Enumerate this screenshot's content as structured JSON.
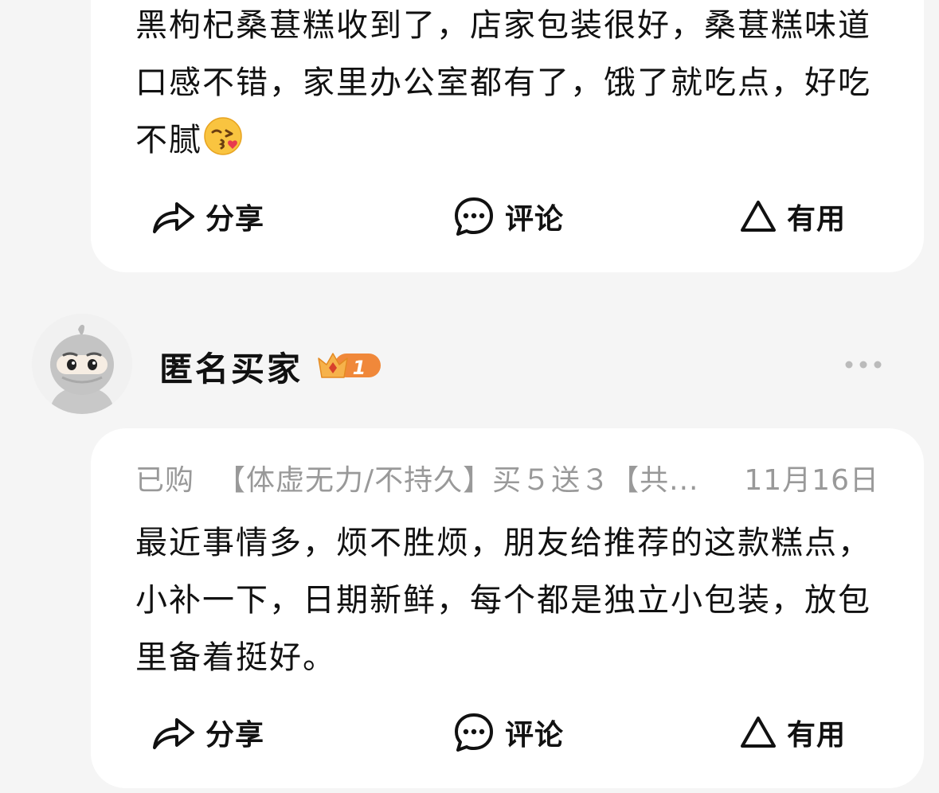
{
  "reviews": [
    {
      "text": "黑枸杞桑葚糕收到了，店家包装很好，桑葚糕味道口感不错，家里办公室都有了，饿了就吃点，好吃不腻",
      "actions": {
        "share": "分享",
        "comment": "评论",
        "useful": "有用"
      }
    },
    {
      "user": {
        "name": "匿名买家",
        "level": "1"
      },
      "purchased_label": "已购",
      "variant": "【体虚无力/不持久】买５送３【共...",
      "date": "11月16日",
      "text": "最近事情多，烦不胜烦，朋友给推荐的这款糕点，小补一下，日期新鲜，每个都是独立小包装，放包里备着挺好。",
      "actions": {
        "share": "分享",
        "comment": "评论",
        "useful": "有用"
      }
    }
  ],
  "colors": {
    "background": "#f5f5f5",
    "card": "#ffffff",
    "text": "#111111",
    "muted": "#999999",
    "badge": "#f0883a"
  },
  "icons": {
    "share": "share-arrow-icon",
    "comment": "comment-bubble-icon",
    "useful": "triangle-useful-icon",
    "more": "more-dots-icon",
    "emoji": "kissing-face-emoji-icon",
    "crown": "crown-level-icon"
  }
}
